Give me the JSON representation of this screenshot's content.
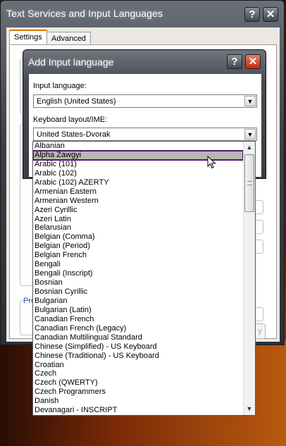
{
  "outer_window": {
    "title": "Text Services and Input Languages",
    "help_glyph": "?",
    "close_glyph": "✕",
    "tabs": [
      {
        "label": "Settings",
        "active": true
      },
      {
        "label": "Advanced",
        "active": false
      }
    ],
    "partial_link": "Pre",
    "partial_button": "y"
  },
  "dialog": {
    "title": "Add Input language",
    "help_glyph": "?",
    "close_glyph": "✕",
    "input_language_label": "Input language:",
    "input_language_value": "English (United States)",
    "keyboard_label": "Keyboard layout/IME:",
    "keyboard_value": "United States-Dvorak"
  },
  "dropdown": {
    "selected_index": 1,
    "items": [
      "Albanian",
      "Alpha Zawgyi",
      "Arabic (101)",
      "Arabic (102)",
      "Arabic (102) AZERTY",
      "Armenian Eastern",
      "Armenian Western",
      "Azeri Cyrillic",
      "Azeri Latin",
      "Belarusian",
      "Belgian (Comma)",
      "Belgian (Period)",
      "Belgian French",
      "Bengali",
      "Bengali (Inscript)",
      "Bosnian",
      "Bosnian Cyrillic",
      "Bulgarian",
      "Bulgarian (Latin)",
      "Canadian French",
      "Canadian French (Legacy)",
      "Canadian Multilingual Standard",
      "Chinese (Simplified) - US Keyboard",
      "Chinese (Traditional) - US Keyboard",
      "Croatian",
      "Czech",
      "Czech (QWERTY)",
      "Czech Programmers",
      "Danish",
      "Devanagari - INSCRIPT"
    ]
  },
  "colors": {
    "selection_outline": "#4a1a70",
    "selection_fill": "#b7b7b7",
    "close_button": "#c42a10"
  },
  "icons": [
    "help-icon",
    "close-icon",
    "chevron-down-icon",
    "chevron-up-icon",
    "mouse-pointer-icon"
  ]
}
